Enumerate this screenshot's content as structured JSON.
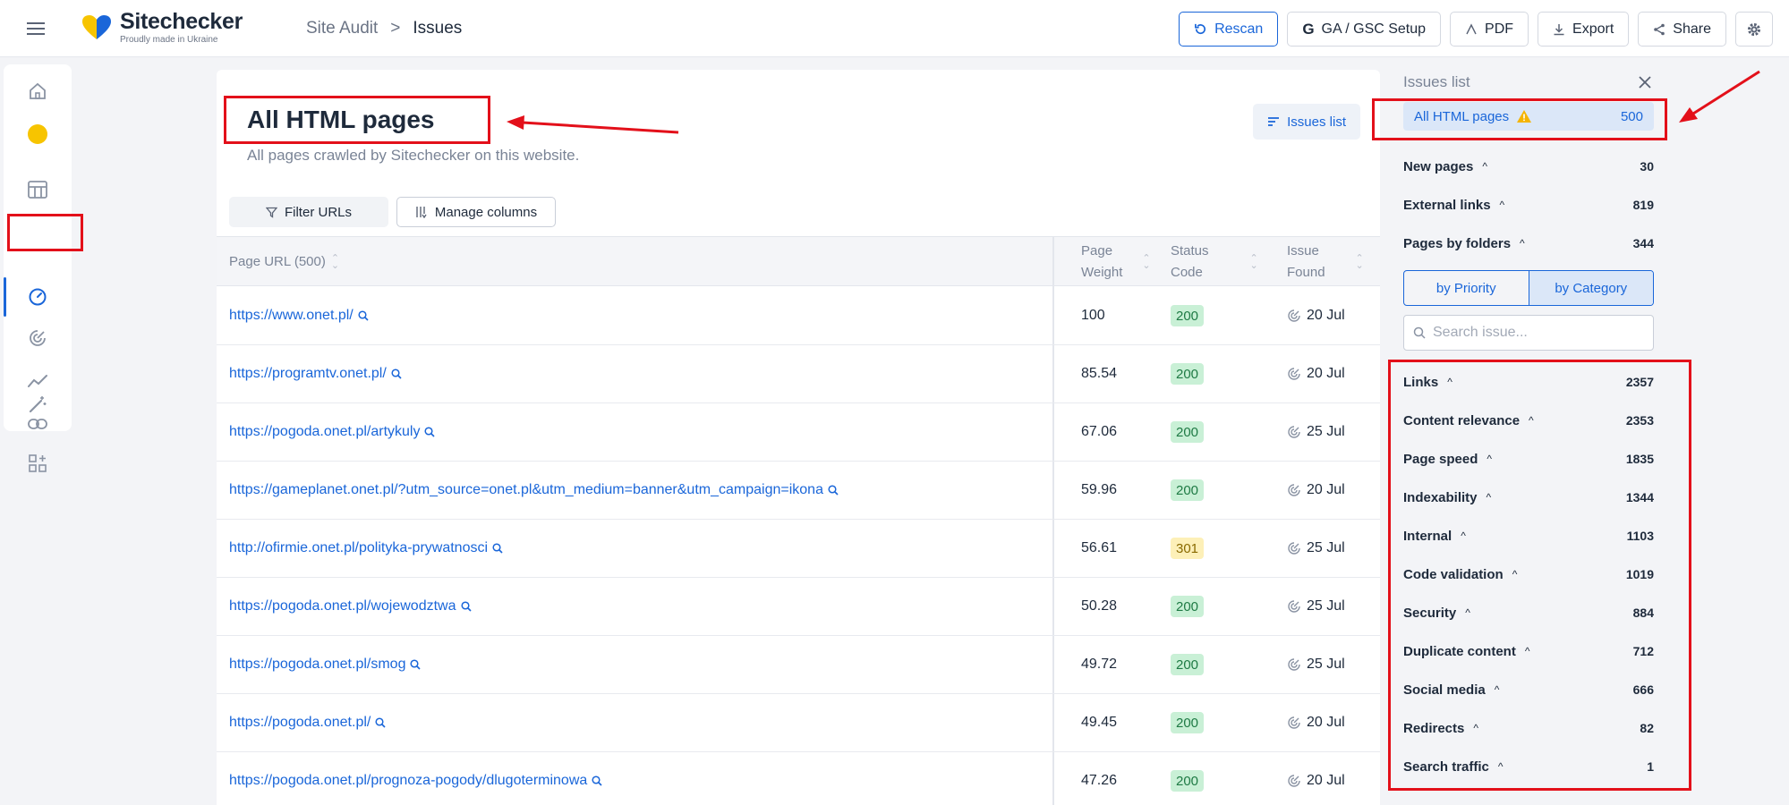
{
  "app": {
    "name": "Sitechecker",
    "tagline": "Proudly made in Ukraine"
  },
  "breadcrumb": {
    "parent": "Site Audit",
    "separator": ">",
    "current": "Issues"
  },
  "toolbar": {
    "rescan": "Rescan",
    "ga_gsc": "GA / GSC Setup",
    "pdf": "PDF",
    "export": "Export",
    "share": "Share"
  },
  "page": {
    "title": "All HTML pages",
    "description": "All pages crawled by Sitechecker on this website.",
    "issues_list_button": "Issues list",
    "filter_button": "Filter URLs",
    "manage_columns_button": "Manage columns"
  },
  "table": {
    "columns": {
      "url": "Page URL (500)",
      "weight": [
        "Page",
        "Weight"
      ],
      "status": [
        "Status",
        "Code"
      ],
      "found": [
        "Issue",
        "Found"
      ]
    },
    "rows": [
      {
        "url": "https://www.onet.pl/",
        "weight": "100",
        "status": "200",
        "status_type": "ok",
        "found": "20 Jul"
      },
      {
        "url": "https://programtv.onet.pl/",
        "weight": "85.54",
        "status": "200",
        "status_type": "ok",
        "found": "20 Jul"
      },
      {
        "url": "https://pogoda.onet.pl/artykuly",
        "weight": "67.06",
        "status": "200",
        "status_type": "ok",
        "found": "25 Jul"
      },
      {
        "url": "https://gameplanet.onet.pl/?utm_source=onet.pl&utm_medium=banner&utm_campaign=ikona",
        "weight": "59.96",
        "status": "200",
        "status_type": "ok",
        "found": "20 Jul"
      },
      {
        "url": "http://ofirmie.onet.pl/polityka-prywatnosci",
        "weight": "56.61",
        "status": "301",
        "status_type": "warn",
        "found": "25 Jul"
      },
      {
        "url": "https://pogoda.onet.pl/wojewodztwa",
        "weight": "50.28",
        "status": "200",
        "status_type": "ok",
        "found": "25 Jul"
      },
      {
        "url": "https://pogoda.onet.pl/smog",
        "weight": "49.72",
        "status": "200",
        "status_type": "ok",
        "found": "25 Jul"
      },
      {
        "url": "https://pogoda.onet.pl/",
        "weight": "49.45",
        "status": "200",
        "status_type": "ok",
        "found": "20 Jul"
      },
      {
        "url": "https://pogoda.onet.pl/prognoza-pogody/dlugoterminowa",
        "weight": "47.26",
        "status": "200",
        "status_type": "ok",
        "found": "20 Jul"
      }
    ]
  },
  "panel": {
    "title": "Issues list",
    "all_pages": {
      "label": "All HTML pages",
      "count": "500"
    },
    "summary": [
      {
        "label": "New pages",
        "count": "30"
      },
      {
        "label": "External links",
        "count": "819"
      },
      {
        "label": "Pages by folders",
        "count": "344"
      }
    ],
    "tabs": [
      "by Priority",
      "by Category"
    ],
    "active_tab": "by Category",
    "search_placeholder": "Search issue...",
    "categories": [
      {
        "label": "Links",
        "count": "2357"
      },
      {
        "label": "Content relevance",
        "count": "2353"
      },
      {
        "label": "Page speed",
        "count": "1835"
      },
      {
        "label": "Indexability",
        "count": "1344"
      },
      {
        "label": "Internal",
        "count": "1103"
      },
      {
        "label": "Code validation",
        "count": "1019"
      },
      {
        "label": "Security",
        "count": "884"
      },
      {
        "label": "Duplicate content",
        "count": "712"
      },
      {
        "label": "Social media",
        "count": "666"
      },
      {
        "label": "Redirects",
        "count": "82"
      },
      {
        "label": "Search traffic",
        "count": "1"
      }
    ]
  },
  "colors": {
    "accent": "#1a66d9",
    "annotation": "#e3101a",
    "status_ok_bg": "#c9f0d6",
    "status_warn_bg": "#fdf0b8"
  }
}
